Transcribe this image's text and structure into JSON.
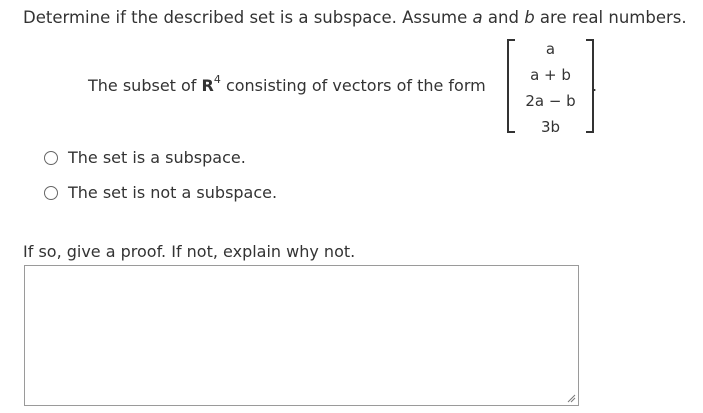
{
  "question": {
    "prefix": "Determine if the described set is a subspace. Assume ",
    "var_a": "a",
    "and": " and ",
    "var_b": "b",
    "suffix": " are real numbers."
  },
  "subset": {
    "text_before": "The subset of ",
    "space": "R",
    "dimension": "4",
    "text_after": " consisting of vectors of the form",
    "vector": [
      "a",
      "a + b",
      "2a − b",
      "3b"
    ],
    "period": "."
  },
  "options": [
    {
      "label": "The set is a subspace.",
      "selected": false
    },
    {
      "label": "The set is not a subspace.",
      "selected": false
    }
  ],
  "proof_prompt": "If so, give a proof. If not, explain why not.",
  "answer_value": ""
}
